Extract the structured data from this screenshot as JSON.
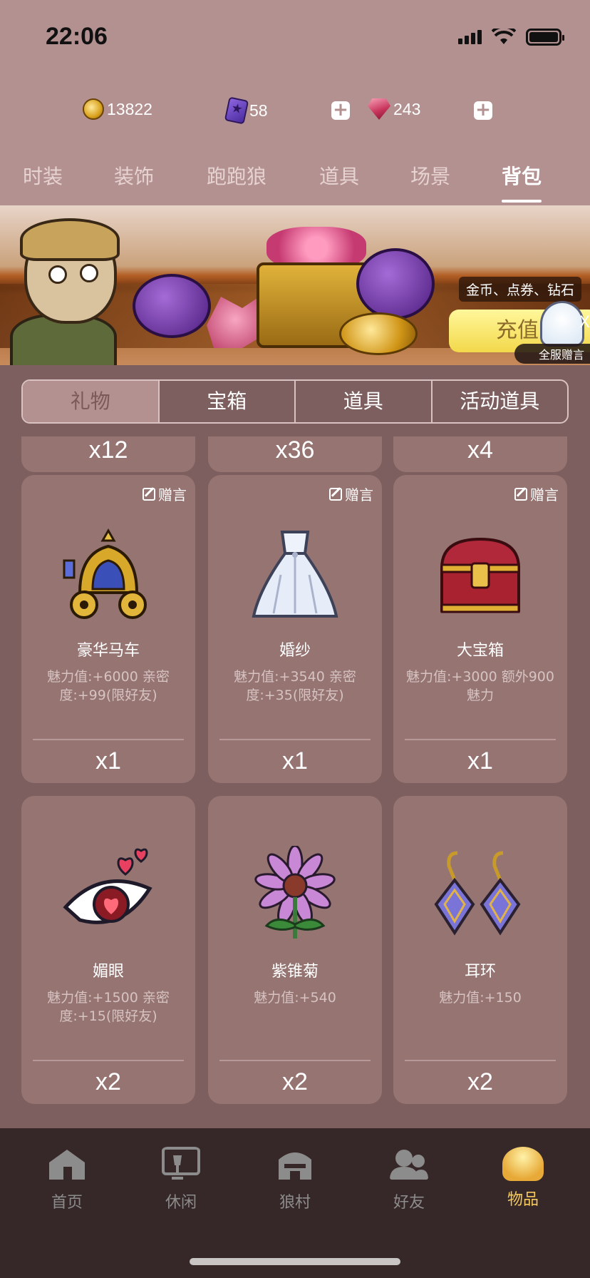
{
  "status": {
    "time": "22:06"
  },
  "currency": {
    "coins": "13822",
    "tickets": "58",
    "gems": "243"
  },
  "main_tabs": [
    "时装",
    "装饰",
    "跑跑狼",
    "道具",
    "场景",
    "背包"
  ],
  "banner": {
    "label": "金币、点券、钻石",
    "button": "充值",
    "broadcast": "全服赠言",
    "close": "X"
  },
  "sub_tabs": [
    "礼物",
    "宝箱",
    "道具",
    "活动道具"
  ],
  "partial_row": [
    "x12",
    "x36",
    "x4"
  ],
  "items": [
    {
      "name": "豪华马车",
      "desc": "魅力值:+6000 亲密度:+99(限好友)",
      "qty": "x1",
      "msg": "赠言",
      "icon": "carriage-icon"
    },
    {
      "name": "婚纱",
      "desc": "魅力值:+3540 亲密度:+35(限好友)",
      "qty": "x1",
      "msg": "赠言",
      "icon": "wedding-dress-icon"
    },
    {
      "name": "大宝箱",
      "desc": "魅力值:+3000 额外900魅力",
      "qty": "x1",
      "msg": "赠言",
      "icon": "treasure-chest-icon"
    },
    {
      "name": "媚眼",
      "desc": "魅力值:+1500 亲密度:+15(限好友)",
      "qty": "x2",
      "icon": "wink-eye-icon"
    },
    {
      "name": "紫锥菊",
      "desc": "魅力值:+540",
      "qty": "x2",
      "icon": "echinacea-flower-icon"
    },
    {
      "name": "耳环",
      "desc": "魅力值:+150",
      "qty": "x2",
      "icon": "earring-icon"
    }
  ],
  "bottom_nav": [
    {
      "label": "首页",
      "icon": "home-icon"
    },
    {
      "label": "休闲",
      "icon": "leisure-icon"
    },
    {
      "label": "狼村",
      "icon": "wolf-village-icon"
    },
    {
      "label": "好友",
      "icon": "friends-icon"
    },
    {
      "label": "物品",
      "icon": "items-icon"
    }
  ]
}
